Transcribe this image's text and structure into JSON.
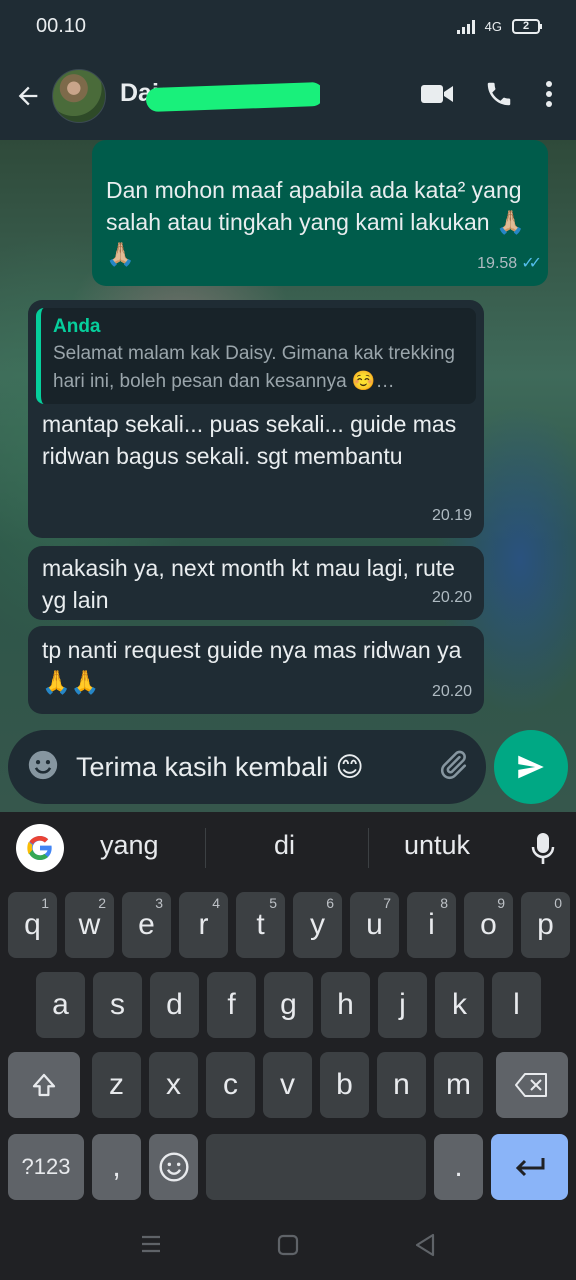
{
  "status_bar": {
    "time": "00.10",
    "network": "4G",
    "battery": "2"
  },
  "header": {
    "contact_name": "Daisy"
  },
  "messages": [
    {
      "type": "outgoing",
      "text": "Dan mohon maaf apabila ada kata² yang salah atau tingkah yang kami lakukan 🙏🏼🙏🏼",
      "time": "19.58"
    },
    {
      "type": "incoming",
      "quote_author": "Anda",
      "quote_text": "Selamat malam kak Daisy. Gimana kak trekking hari ini, boleh pesan dan kesannya ☺️…",
      "text": "mantap sekali... puas sekali... guide mas ridwan bagus sekali. sgt membantu",
      "time": "20.19"
    },
    {
      "type": "incoming",
      "text": "makasih ya, next month kt mau lagi, rute yg lain",
      "time": "20.20"
    },
    {
      "type": "incoming",
      "text": "tp nanti request guide nya mas ridwan ya🙏🙏",
      "time": "20.20"
    }
  ],
  "composer": {
    "text": "Terima kasih kembali 😊"
  },
  "keyboard": {
    "suggestions": [
      "yang",
      "di",
      "untuk"
    ],
    "row1": [
      "q",
      "w",
      "e",
      "r",
      "t",
      "y",
      "u",
      "i",
      "o",
      "p"
    ],
    "row1_hints": [
      "1",
      "2",
      "3",
      "4",
      "5",
      "6",
      "7",
      "8",
      "9",
      "0"
    ],
    "row2": [
      "a",
      "s",
      "d",
      "f",
      "g",
      "h",
      "j",
      "k",
      "l"
    ],
    "row3": [
      "z",
      "x",
      "c",
      "v",
      "b",
      "n",
      "m"
    ],
    "symbols_key": "?123",
    "comma_key": ",",
    "period_key": "."
  }
}
